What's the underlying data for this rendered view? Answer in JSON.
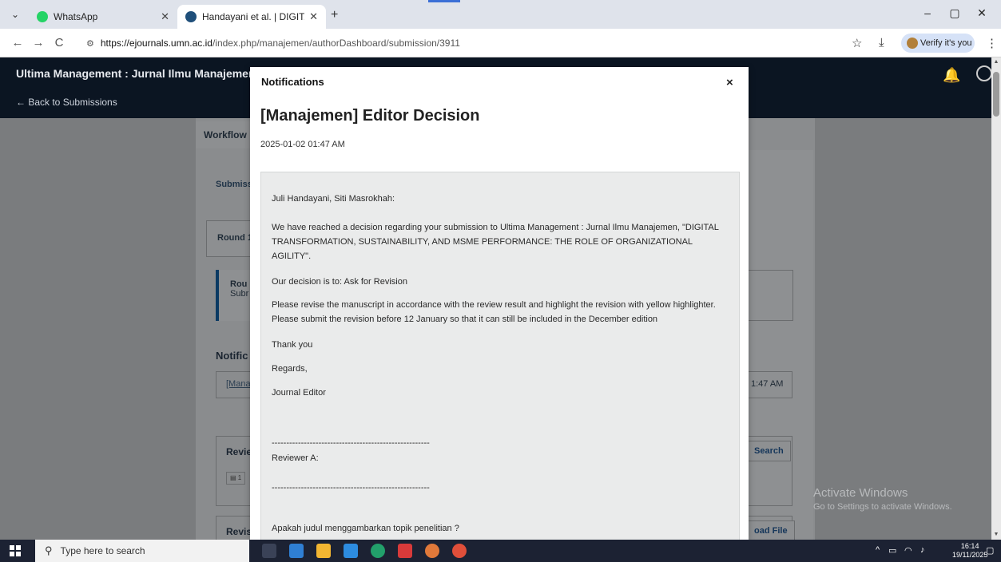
{
  "browser": {
    "tabs": [
      {
        "label": "WhatsApp",
        "favicon_color": "#25d366"
      },
      {
        "label": "Handayani et al. | DIGITAL TRAI",
        "favicon_color": "#1f4f7a"
      }
    ],
    "new_tab": "+",
    "window_controls": {
      "minimize": "–",
      "restore": "▢",
      "close": "✕"
    },
    "nav": {
      "back": "←",
      "forward": "→",
      "reload": "C"
    },
    "url_host": "https://ejournals.umn.ac.id",
    "url_path": "/index.php/manajemen/authorDashboard/submission/3911",
    "verify_label": "Verify it's you"
  },
  "page": {
    "journal_title": "Ultima Management : Jurnal Ilmu Manajemen",
    "back_link": "← Back to Submissions",
    "workflow_tab": "Workflow",
    "submission_tab_partial": "Submiss",
    "round_tab_partial": "Round 1",
    "round_note_title_partial": "Rou",
    "round_note_text_partial": "Subr",
    "notifications_label_partial": "Notific",
    "notification_link_partial": "[Mana",
    "notification_date_partial": "1:47 AM",
    "review_section_partial": "Revie",
    "review_search_button": "Search",
    "revision_section_partial": "Revis",
    "upload_file_button_partial": "oad File",
    "file_icon_partial": "1"
  },
  "modal": {
    "title": "Notifications",
    "close": "×",
    "heading": "[Manajemen] Editor Decision",
    "date": "2025-01-02 01:47 AM",
    "message": {
      "salutation": "Juli Handayani, Siti Masrokhah:",
      "paragraph_1": "We have reached a decision regarding your submission to Ultima Management : Jurnal Ilmu Manajemen, \"DIGITAL TRANSFORMATION, SUSTAINABILITY, AND MSME PERFORMANCE: THE ROLE OF ORGANIZATIONAL AGILITY\".",
      "decision": "Our decision is to: Ask for Revision",
      "paragraph_2": "Please revise the manuscript in accordance with the review result and highlight the revision with yellow highlighter. Please submit the revision before 12 January so that it can still be included in the December edition",
      "thanks": "Thank you",
      "regards": "Regards,",
      "signature": "Journal Editor",
      "separator_1": "------------------------------------------------------",
      "reviewer": "Reviewer A:",
      "separator_2": "------------------------------------------------------",
      "question": "Apakah judul menggambarkan topik penelitian ?"
    }
  },
  "watermark": {
    "line1": "Activate Windows",
    "line2": "Go to Settings to activate Windows."
  },
  "taskbar": {
    "search_placeholder": "Type here to search",
    "time": "16:14",
    "date": "19/11/2025"
  }
}
